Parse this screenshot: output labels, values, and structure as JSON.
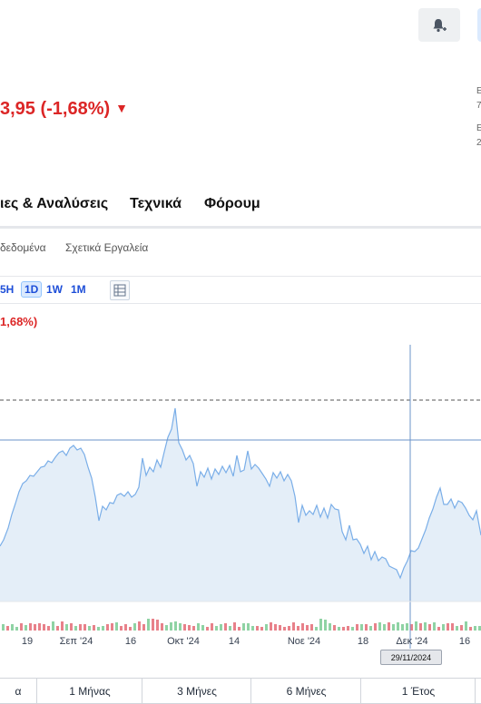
{
  "header": {
    "price_change": "3,95 (-1,68%)",
    "bell_icon": "bell-plus-icon",
    "side_fragments": [
      "E",
      "7",
      "E",
      "2"
    ]
  },
  "tabs": [
    {
      "label": "ιες & Αναλύσεις"
    },
    {
      "label": "Τεχνικά"
    },
    {
      "label": "Φόρουμ"
    }
  ],
  "subnav": [
    {
      "label": "δεδομένα"
    },
    {
      "label": "Σχετικά Εργαλεία"
    }
  ],
  "intervals": [
    {
      "label": "5H",
      "active": false
    },
    {
      "label": "1D",
      "active": true
    },
    {
      "label": "1W",
      "active": false
    },
    {
      "label": "1M",
      "active": false
    }
  ],
  "chart_toolbar_icon": "table-icon",
  "chart_change": "1,68%)",
  "chart_data": {
    "type": "area",
    "x_ticks": [
      "19",
      "Σεπ '24",
      "16",
      "Οκτ '24",
      "14",
      "Νοε '24",
      "18",
      "Δεκ '24",
      "16"
    ],
    "crosshair_date": "29/11/2024",
    "colors": {
      "line": "#7aaee8",
      "fill": "#e4eef8",
      "up_volume": "#8fd3a4",
      "down_volume": "#e8818a",
      "crosshair": "#6b93c8"
    }
  },
  "periods": [
    {
      "label": "α"
    },
    {
      "label": "1 Μήνας"
    },
    {
      "label": "3 Μήνες"
    },
    {
      "label": "6 Μήνες"
    },
    {
      "label": "1 Έτος"
    }
  ]
}
